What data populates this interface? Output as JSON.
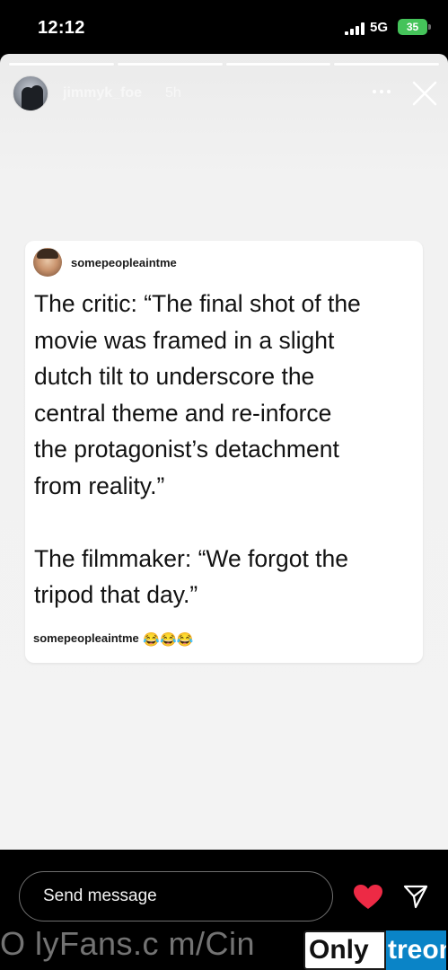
{
  "status_bar": {
    "time": "12:12",
    "network": "5G",
    "battery": "35",
    "battery_color": "#45c35a"
  },
  "story": {
    "progress_segments": 4,
    "username": "jimmyk_foe",
    "time_ago": "5h",
    "more_icon": "more-horizontal-icon",
    "close_icon": "close-icon"
  },
  "post": {
    "author": "somepeopleaintme",
    "text": "The critic: “The final shot of the\nmovie was framed in a slight\ndutch tilt to underscore the\ncentral theme and re-inforce\nthe protagonist’s detachment\nfrom reality.”\n\nThe filmmaker: “We forgot the\ntripod that day.”",
    "footer_author": "somepeopleaintme",
    "footer_emojis": "😂😂😂"
  },
  "bottom_bar": {
    "message_placeholder": "Send message",
    "heart_icon": "heart-icon",
    "heart_color": "#ed2a45",
    "send_icon": "send-icon"
  },
  "watermark": {
    "text": "O lyFans.c m/Cin",
    "logo_only": "Only",
    "logo_treon": "treon",
    "logo_color": "#0a84c7"
  }
}
